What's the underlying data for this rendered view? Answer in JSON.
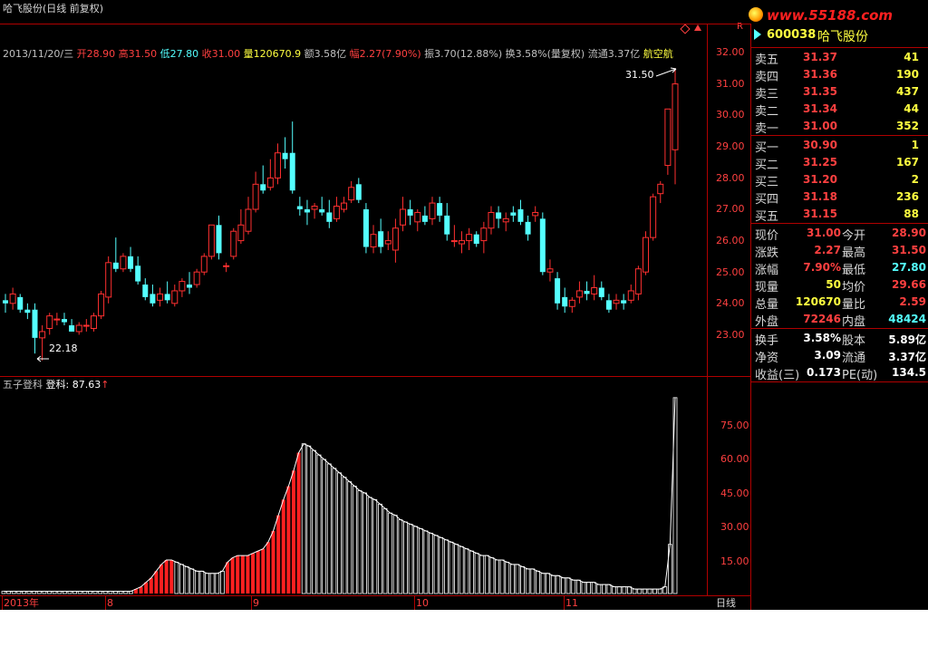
{
  "window": {
    "title": "哈飞股份(日线 前复权)",
    "logo_text": "www.55188.com",
    "corner_mark": "R"
  },
  "info_bar": {
    "date": "2013/11/20/三",
    "open_label": "开",
    "open": "28.90",
    "high_label": "高",
    "high": "31.50",
    "low_label": "低",
    "low": "27.80",
    "close_label": "收",
    "close": "31.00",
    "vol_label": "量",
    "vol": "120670.9",
    "amt_label": "额",
    "amt": "3.58亿",
    "chg_label": "幅",
    "chg": "2.27(7.90%)",
    "amp_label": "振",
    "amp": "3.70(12.88%)",
    "turn_label": "换",
    "turn": "3.58%(量复权)",
    "float_label": "流通",
    "float": "3.37亿",
    "sector": "航空航"
  },
  "price_chart": {
    "high_annotation": "31.50",
    "low_annotation": "22.18",
    "price_axis": [
      "32.00",
      "31.00",
      "30.00",
      "29.00",
      "28.00",
      "27.00",
      "26.00",
      "25.00",
      "24.00",
      "23.00"
    ],
    "candle_colors": {
      "up": "#ff3030",
      "down": "#54ffff",
      "edge": "#ffffff"
    }
  },
  "indicator": {
    "name": "五子登科",
    "value_label": "登科: 87.63",
    "axis": [
      "75.00",
      "60.00",
      "45.00",
      "30.00",
      "15.00"
    ]
  },
  "time_axis": {
    "labels": [
      "2013年",
      "8",
      "9",
      "10",
      "11"
    ],
    "period_button": "日线"
  },
  "stock": {
    "code": "600038",
    "name": "哈飞股份"
  },
  "order_book": {
    "sell": [
      {
        "label": "卖五",
        "price": "31.37",
        "vol": "41"
      },
      {
        "label": "卖四",
        "price": "31.36",
        "vol": "190"
      },
      {
        "label": "卖三",
        "price": "31.35",
        "vol": "437"
      },
      {
        "label": "卖二",
        "price": "31.34",
        "vol": "44"
      },
      {
        "label": "卖一",
        "price": "31.00",
        "vol": "352"
      }
    ],
    "buy": [
      {
        "label": "买一",
        "price": "30.90",
        "vol": "1"
      },
      {
        "label": "买二",
        "price": "31.25",
        "vol": "167"
      },
      {
        "label": "买三",
        "price": "31.20",
        "vol": "2"
      },
      {
        "label": "买四",
        "price": "31.18",
        "vol": "236"
      },
      {
        "label": "买五",
        "price": "31.15",
        "vol": "88"
      }
    ]
  },
  "stats": [
    {
      "k1": "现价",
      "v1": "31.00",
      "c1": "#ff4040",
      "k2": "今开",
      "v2": "28.90",
      "c2": "#ff4040"
    },
    {
      "k1": "涨跌",
      "v1": "2.27",
      "c1": "#ff4040",
      "k2": "最高",
      "v2": "31.50",
      "c2": "#ff4040"
    },
    {
      "k1": "涨幅",
      "v1": "7.90%",
      "c1": "#ff4040",
      "k2": "最低",
      "v2": "27.80",
      "c2": "#54ffff"
    },
    {
      "k1": "现量",
      "v1": "50",
      "c1": "#ffff40",
      "k2": "均价",
      "v2": "29.66",
      "c2": "#ff4040"
    },
    {
      "k1": "总量",
      "v1": "120670",
      "c1": "#ffff40",
      "k2": "量比",
      "v2": "2.59",
      "c2": "#ff4040"
    },
    {
      "k1": "外盘",
      "v1": "72246",
      "c1": "#ff4040",
      "k2": "内盘",
      "v2": "48424",
      "c2": "#54ffff"
    }
  ],
  "fundamentals": [
    {
      "k1": "换手",
      "v1": "3.58%",
      "k2": "股本",
      "v2": "5.89亿"
    },
    {
      "k1": "净资",
      "v1": "3.09",
      "k2": "流通",
      "v2": "3.37亿"
    },
    {
      "k1": "收益(三)",
      "v1": "0.173",
      "k2": "PE(动)",
      "v2": "134.5"
    }
  ],
  "chart_data": [
    {
      "type": "candlestick",
      "ylim": [
        22.0,
        32.5
      ],
      "candles": [
        [
          24.1,
          24.3,
          23.7,
          24.0
        ],
        [
          24.0,
          24.5,
          23.8,
          24.3
        ],
        [
          24.2,
          24.3,
          23.7,
          23.8
        ],
        [
          23.8,
          24.0,
          23.5,
          23.7
        ],
        [
          23.8,
          24.0,
          22.4,
          22.9
        ],
        [
          22.9,
          23.3,
          22.18,
          23.1
        ],
        [
          23.2,
          23.7,
          23.0,
          23.6
        ],
        [
          23.5,
          23.7,
          23.3,
          23.5
        ],
        [
          23.5,
          23.7,
          23.3,
          23.4
        ],
        [
          23.3,
          23.5,
          23.1,
          23.1
        ],
        [
          23.1,
          23.4,
          23.0,
          23.3
        ],
        [
          23.3,
          23.5,
          23.1,
          23.3
        ],
        [
          23.2,
          23.7,
          23.1,
          23.6
        ],
        [
          23.6,
          24.4,
          23.5,
          24.3
        ],
        [
          24.2,
          25.5,
          24.0,
          25.3
        ],
        [
          25.3,
          26.1,
          25.0,
          25.1
        ],
        [
          25.1,
          25.6,
          25.0,
          25.5
        ],
        [
          25.5,
          25.8,
          25.0,
          25.1
        ],
        [
          25.2,
          25.5,
          24.6,
          24.7
        ],
        [
          24.6,
          24.8,
          24.1,
          24.2
        ],
        [
          24.3,
          24.6,
          23.9,
          24.0
        ],
        [
          24.1,
          24.5,
          23.9,
          24.3
        ],
        [
          24.3,
          24.7,
          24.0,
          24.1
        ],
        [
          24.0,
          24.6,
          23.9,
          24.4
        ],
        [
          24.4,
          24.8,
          24.2,
          24.7
        ],
        [
          24.6,
          25.0,
          24.3,
          24.5
        ],
        [
          24.6,
          25.1,
          24.5,
          25.0
        ],
        [
          25.0,
          25.6,
          24.9,
          25.5
        ],
        [
          25.5,
          26.5,
          25.4,
          26.5
        ],
        [
          26.5,
          26.8,
          25.4,
          25.6
        ],
        [
          25.2,
          25.3,
          25.0,
          25.2
        ],
        [
          25.5,
          26.4,
          25.4,
          26.3
        ],
        [
          26.0,
          27.0,
          25.9,
          26.5
        ],
        [
          26.3,
          27.4,
          26.2,
          27.0
        ],
        [
          27.0,
          28.2,
          26.9,
          27.8
        ],
        [
          27.8,
          28.4,
          27.5,
          27.6
        ],
        [
          27.7,
          28.6,
          27.6,
          28.0
        ],
        [
          28.0,
          29.1,
          27.8,
          28.8
        ],
        [
          28.8,
          29.3,
          28.3,
          28.6
        ],
        [
          28.8,
          29.8,
          27.5,
          27.6
        ],
        [
          27.1,
          27.4,
          26.8,
          27.0
        ],
        [
          27.0,
          27.3,
          26.5,
          26.9
        ],
        [
          27.0,
          27.2,
          26.7,
          27.1
        ],
        [
          27.0,
          27.4,
          26.8,
          26.9
        ],
        [
          26.9,
          27.3,
          26.4,
          26.6
        ],
        [
          26.7,
          27.4,
          26.6,
          27.1
        ],
        [
          27.0,
          27.4,
          26.9,
          27.2
        ],
        [
          27.3,
          27.9,
          27.2,
          27.7
        ],
        [
          27.8,
          28.0,
          27.2,
          27.3
        ],
        [
          27.0,
          27.2,
          25.6,
          25.8
        ],
        [
          25.8,
          26.5,
          25.6,
          26.2
        ],
        [
          26.3,
          26.7,
          25.6,
          25.8
        ],
        [
          25.9,
          26.3,
          25.7,
          26.0
        ],
        [
          25.7,
          26.7,
          25.3,
          26.4
        ],
        [
          26.5,
          27.4,
          26.3,
          27.0
        ],
        [
          27.0,
          27.3,
          26.5,
          26.8
        ],
        [
          26.6,
          27.0,
          26.3,
          26.9
        ],
        [
          26.8,
          27.1,
          26.5,
          26.6
        ],
        [
          26.7,
          27.4,
          26.5,
          27.2
        ],
        [
          27.2,
          27.4,
          26.6,
          26.8
        ],
        [
          26.8,
          27.2,
          26.0,
          26.2
        ],
        [
          26.0,
          26.5,
          25.8,
          26.0
        ],
        [
          25.9,
          26.3,
          25.6,
          26.0
        ],
        [
          26.0,
          26.4,
          25.7,
          26.2
        ],
        [
          26.2,
          26.3,
          25.8,
          25.9
        ],
        [
          26.0,
          26.6,
          25.6,
          26.4
        ],
        [
          26.4,
          27.1,
          26.2,
          26.9
        ],
        [
          26.9,
          27.1,
          26.4,
          26.7
        ],
        [
          26.6,
          26.9,
          26.3,
          26.7
        ],
        [
          26.9,
          27.1,
          26.6,
          26.8
        ],
        [
          27.0,
          27.3,
          26.5,
          26.6
        ],
        [
          26.6,
          26.8,
          26.0,
          26.2
        ],
        [
          26.8,
          27.1,
          26.6,
          26.9
        ],
        [
          26.7,
          26.9,
          24.9,
          25.0
        ],
        [
          25.0,
          25.4,
          24.7,
          25.1
        ],
        [
          24.8,
          25.0,
          23.8,
          24.0
        ],
        [
          24.2,
          24.5,
          23.7,
          23.9
        ],
        [
          23.9,
          24.2,
          23.7,
          24.1
        ],
        [
          24.2,
          24.7,
          24.0,
          24.4
        ],
        [
          24.4,
          24.7,
          24.1,
          24.3
        ],
        [
          24.3,
          24.9,
          24.1,
          24.5
        ],
        [
          24.5,
          24.7,
          24.1,
          24.2
        ],
        [
          24.1,
          24.3,
          23.7,
          23.8
        ],
        [
          24.0,
          24.3,
          23.8,
          24.1
        ],
        [
          24.1,
          24.3,
          23.8,
          24.0
        ],
        [
          24.1,
          24.6,
          24.0,
          24.4
        ],
        [
          24.3,
          25.2,
          24.1,
          25.1
        ],
        [
          25.0,
          26.3,
          24.9,
          26.1
        ],
        [
          26.1,
          27.5,
          26.0,
          27.4
        ],
        [
          27.5,
          27.9,
          27.2,
          27.8
        ],
        [
          28.4,
          29.0,
          28.1,
          30.2
        ],
        [
          28.9,
          31.5,
          27.8,
          31.0
        ]
      ]
    },
    {
      "type": "bar",
      "title": "五子登科",
      "ylim": [
        0,
        90
      ],
      "values": [
        1,
        1,
        1,
        1,
        1,
        1,
        1,
        1,
        1,
        1,
        1,
        1,
        1,
        1,
        1,
        1,
        1,
        1,
        1,
        1,
        1,
        1,
        1,
        1,
        1,
        1,
        2,
        3,
        5,
        7,
        10,
        13,
        15,
        15,
        14,
        13,
        12,
        11,
        10,
        10,
        9,
        9,
        9,
        10,
        14,
        16,
        17,
        17,
        17,
        18,
        19,
        20,
        23,
        28,
        35,
        42,
        48,
        55,
        63,
        67,
        66,
        64,
        62,
        60,
        58,
        56,
        54,
        52,
        50,
        48,
        46,
        45,
        43,
        42,
        40,
        38,
        36,
        35,
        33,
        32,
        31,
        30,
        29,
        28,
        27,
        26,
        25,
        24,
        23,
        22,
        21,
        20,
        19,
        18,
        17,
        17,
        16,
        15,
        15,
        14,
        13,
        13,
        12,
        11,
        11,
        10,
        9,
        9,
        8,
        8,
        7,
        7,
        6,
        6,
        5,
        5,
        5,
        4,
        4,
        4,
        3,
        3,
        3,
        3,
        2,
        2,
        2,
        2,
        2,
        2,
        3,
        22,
        87.63
      ],
      "red_indices": [
        26,
        27,
        28,
        29,
        30,
        31,
        32,
        33,
        44,
        45,
        46,
        47,
        48,
        49,
        50,
        51,
        52,
        53,
        54,
        55,
        56,
        57,
        58,
        137,
        138
      ],
      "highlight_index": 136
    }
  ]
}
